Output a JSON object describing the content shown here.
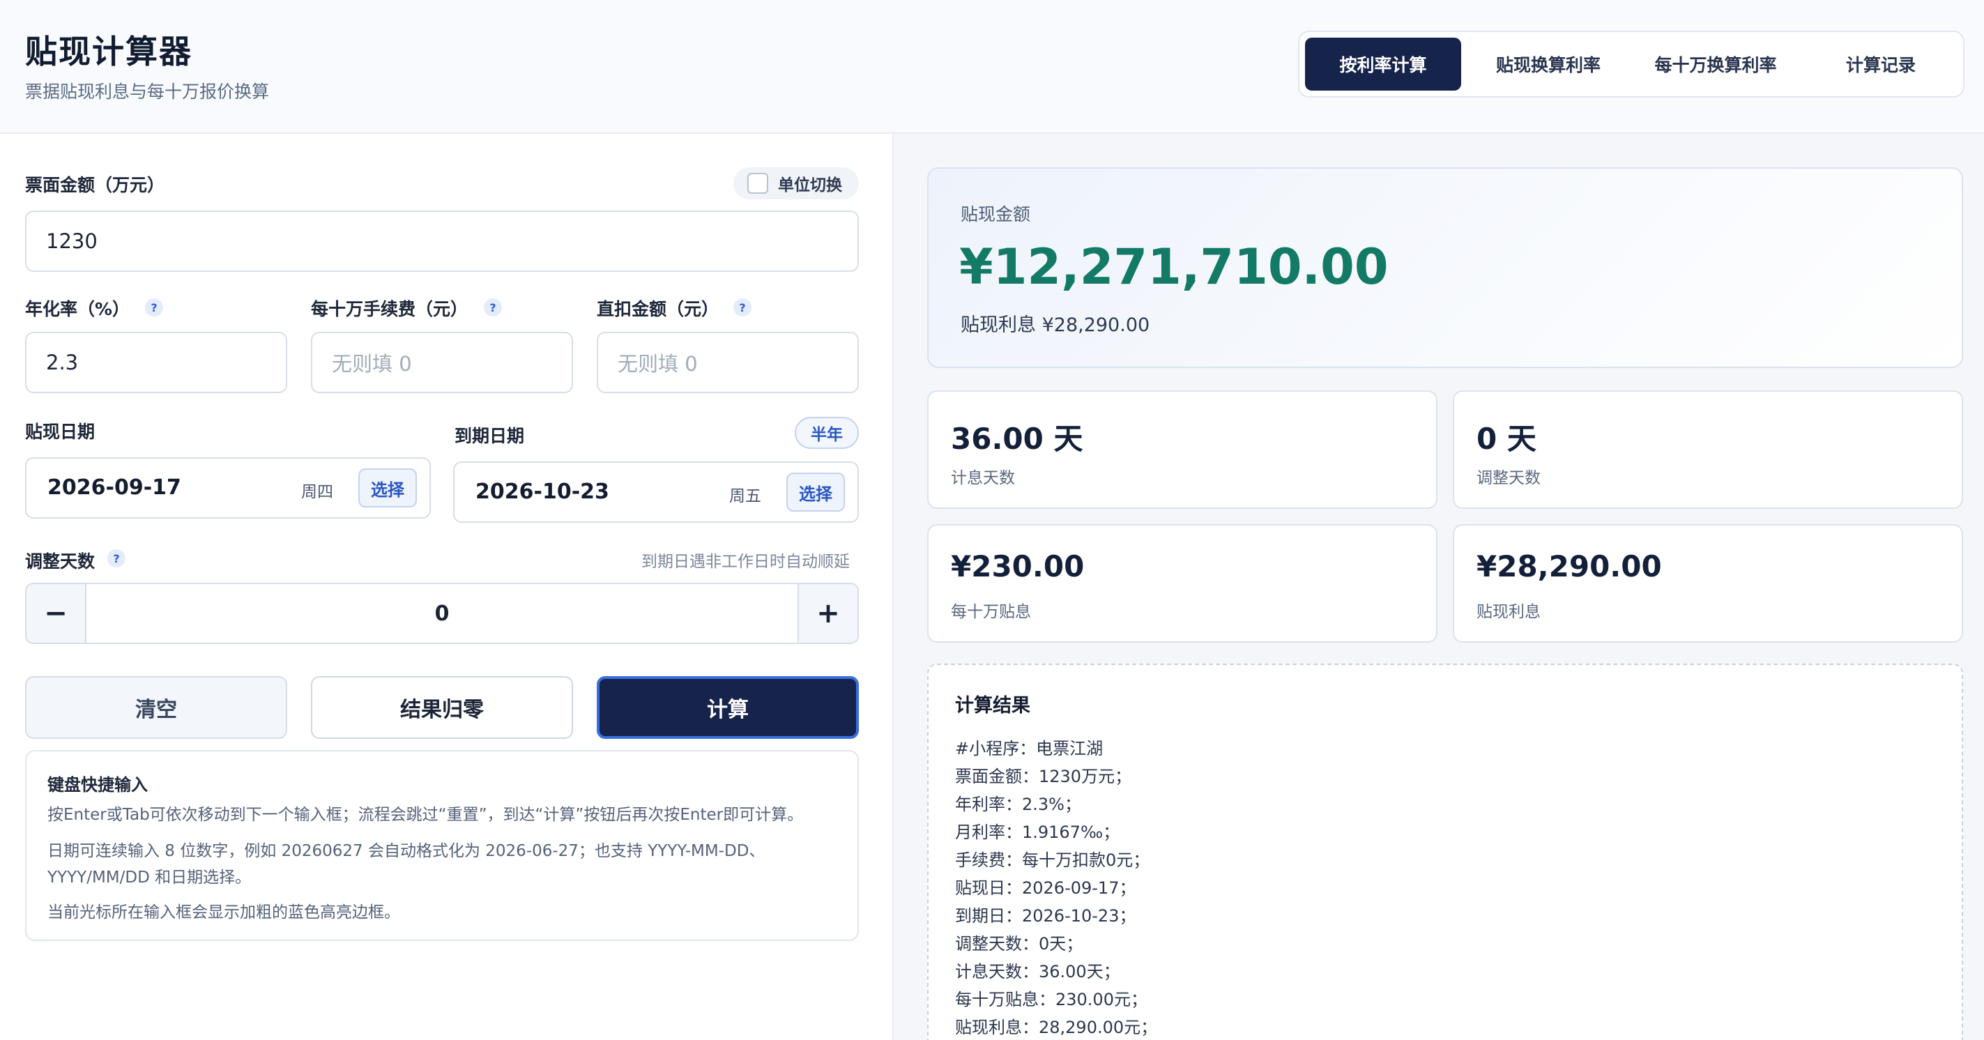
{
  "header": {
    "title": "贴现计算器",
    "subtitle": "票据贴现利息与每十万报价换算",
    "tabs": [
      {
        "label": "按利率计算",
        "active": true
      },
      {
        "label": "贴现换算利率",
        "active": false
      },
      {
        "label": "每十万换算利率",
        "active": false
      },
      {
        "label": "计算记录",
        "active": false
      }
    ]
  },
  "form": {
    "face_amount": {
      "label": "票面金额（万元）",
      "value": "1230"
    },
    "unit_toggle": {
      "label": "单位切换",
      "checked": false
    },
    "rate": {
      "label": "年化率（%）",
      "value": "2.3",
      "help": "?"
    },
    "fee": {
      "label": "每十万手续费（元）",
      "placeholder": "无则填 0",
      "help": "?"
    },
    "deduct": {
      "label": "直扣金额（元）",
      "placeholder": "无则填 0",
      "help": "?"
    },
    "discount_date": {
      "label": "贴现日期",
      "value": "2026-09-17",
      "weekday": "周四",
      "pick": "选择"
    },
    "due_date": {
      "label": "到期日期",
      "value": "2026-10-23",
      "weekday": "周五",
      "pick": "选择",
      "halfyear": "半年"
    },
    "adjust_days": {
      "label": "调整天数",
      "help": "?",
      "hint": "到期日遇非工作日时自动顺延",
      "value": "0",
      "minus": "−",
      "plus": "+"
    },
    "actions": {
      "clear": "清空",
      "reset": "结果归零",
      "calc": "计算"
    }
  },
  "keyboard": {
    "title": "键盘快捷输入",
    "lines": [
      "按Enter或Tab可依次移动到下一个输入框；流程会跳过“重置”，到达“计算”按钮后再次按Enter即可计算。",
      "日期可连续输入 8 位数字，例如 20260627 会自动格式化为 2026-06-27；也支持 YYYY-MM-DD、",
      "YYYY/MM/DD 和日期选择。",
      "当前光标所在输入框会显示加粗的蓝色高亮边框。"
    ]
  },
  "summary": {
    "label": "贴现金额",
    "amount": "¥12,271,710.00",
    "interest_line": "贴现利息 ¥28,290.00"
  },
  "stats": [
    {
      "value": "36.00 天",
      "label": "计息天数"
    },
    {
      "value": "0 天",
      "label": "调整天数"
    },
    {
      "value": "¥230.00",
      "label": "每十万贴息"
    },
    {
      "value": "¥28,290.00",
      "label": "贴现利息"
    }
  ],
  "result": {
    "title": "计算结果",
    "lines": [
      "#小程序：电票江湖",
      "票面金额：1230万元；",
      "年利率：2.3%；",
      "月利率：1.9167‰；",
      "手续费：每十万扣款0元；",
      "贴现日：2026-09-17；",
      "到期日：2026-10-23；",
      "调整天数：0天；",
      "计息天数：36.00天；",
      "每十万贴息：230.00元；",
      "贴现利息：28,290.00元；"
    ]
  },
  "colors": {
    "primary": "#16234a",
    "accent_green": "#137a66",
    "link_blue": "#2857c4"
  }
}
